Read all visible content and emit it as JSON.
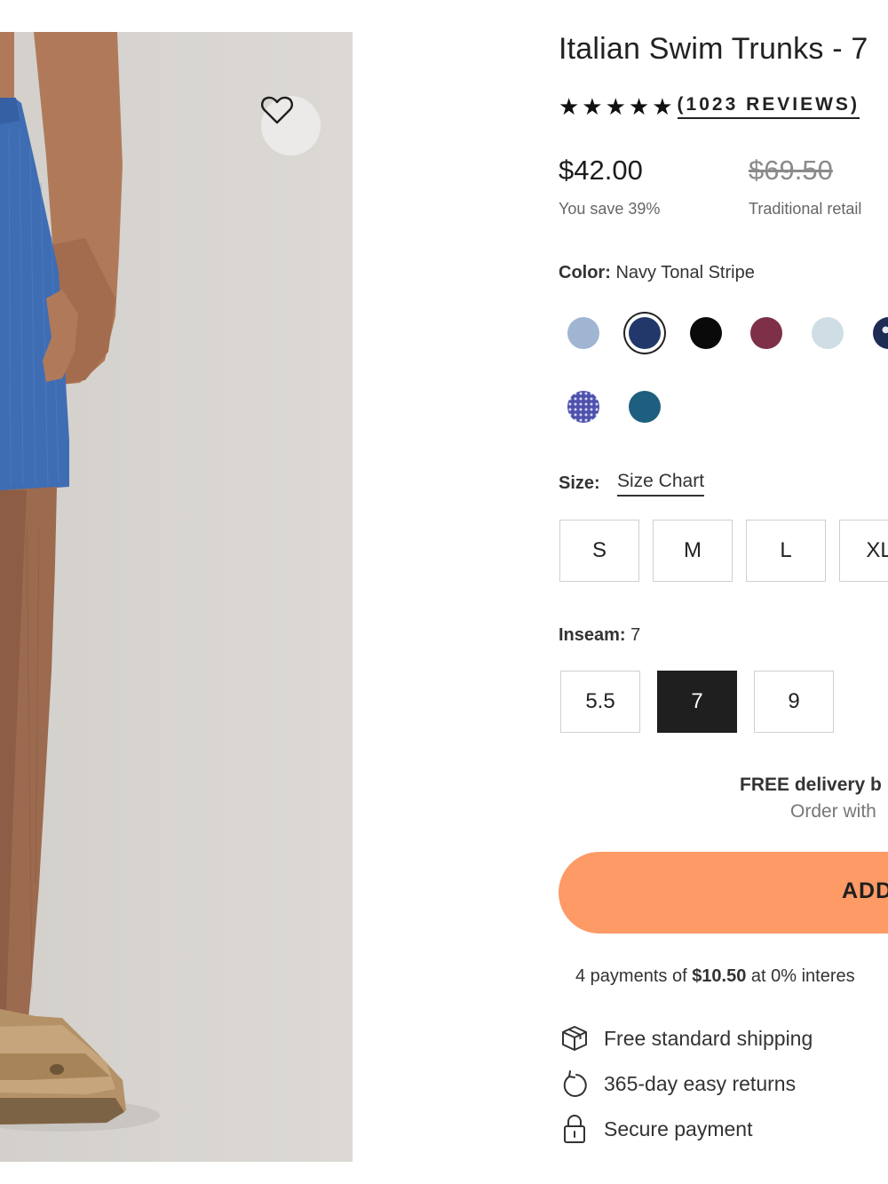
{
  "product": {
    "title": "Italian Swim Trunks - 7",
    "stars": "★★★★★",
    "reviews": "(1023 REVIEWS)",
    "price": "$42.00",
    "savings": "You save 39%",
    "retail_price": "$69.50",
    "retail_label": "Traditional retail"
  },
  "color": {
    "label": "Color:",
    "selected": "Navy Tonal Stripe",
    "swatches": [
      {
        "name": "light-blue",
        "color": "#9fb5d2"
      },
      {
        "name": "navy-tonal-stripe",
        "color": "#23386a"
      },
      {
        "name": "black",
        "color": "#0a0a0a"
      },
      {
        "name": "burgundy",
        "color": "#7e3049"
      },
      {
        "name": "pale-blue",
        "color": "#cfdde5"
      },
      {
        "name": "navy-pattern",
        "color": "#1d2b55"
      },
      {
        "name": "purple-dot",
        "color": "#4f52ac"
      },
      {
        "name": "teal",
        "color": "#1e5f80"
      }
    ]
  },
  "size": {
    "label": "Size:",
    "chart_link": "Size Chart",
    "options": [
      "S",
      "M",
      "L",
      "XL"
    ]
  },
  "inseam": {
    "label": "Inseam:",
    "value": "7",
    "options": [
      "5.5",
      "7",
      "9"
    ],
    "selected": "7"
  },
  "delivery": {
    "line1": "FREE delivery b",
    "line2": "Order with"
  },
  "cart": {
    "button_label": "ADD"
  },
  "payments": {
    "prefix": "4 payments of ",
    "amount": "$10.50",
    "suffix": " at 0% interes"
  },
  "perks": [
    "Free standard shipping",
    "365-day easy returns",
    "Secure payment"
  ],
  "colors": {
    "accent": "#fd9a66",
    "selected_option": "#1f1f1f",
    "image_background": "#d6d3cf",
    "shorts": "#3f6db4"
  }
}
